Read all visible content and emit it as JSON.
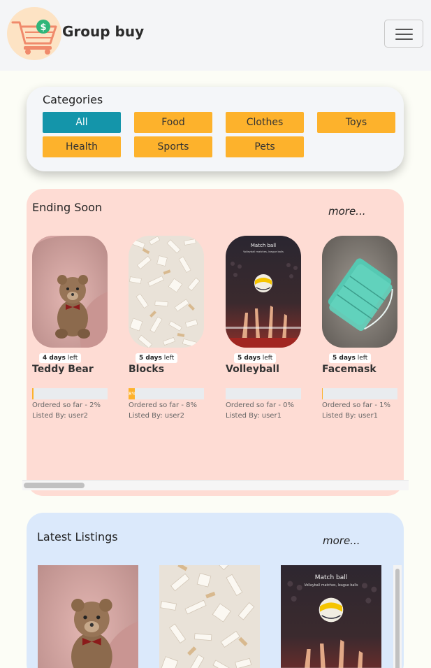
{
  "brand": {
    "title": "Group buy",
    "logo": "shopping-cart-dollar-logo"
  },
  "navbar": {
    "toggler_icon": "hamburger-menu-icon"
  },
  "categories": {
    "title": "Categories",
    "items": [
      {
        "label": "All",
        "active": true
      },
      {
        "label": "Food",
        "active": false
      },
      {
        "label": "Clothes",
        "active": false
      },
      {
        "label": "Toys",
        "active": false
      },
      {
        "label": "Health",
        "active": false
      },
      {
        "label": "Sports",
        "active": false
      },
      {
        "label": "Pets",
        "active": false
      }
    ]
  },
  "ending_soon": {
    "title": "Ending Soon",
    "more_label": "more...",
    "items": [
      {
        "name": "Teddy Bear",
        "days_num": "4 days",
        "days_suffix": "left",
        "progress": 2,
        "ordered_label": "Ordered so far - 2%",
        "listed_label": "Listed By: user2",
        "image": "teddy-bear"
      },
      {
        "name": "Blocks",
        "days_num": "5 days",
        "days_suffix": "left",
        "progress": 8,
        "progress_label": "8%",
        "ordered_label": "Ordered so far - 8%",
        "listed_label": "Listed By: user2",
        "image": "blocks"
      },
      {
        "name": "Volleyball",
        "days_num": "5 days",
        "days_suffix": "left",
        "progress": 0,
        "ordered_label": "Ordered so far - 0%",
        "listed_label": "Listed By: user1",
        "image": "volleyball",
        "image_text_title": "Match ball",
        "image_text_sub": "Volleyball matches, league balls"
      },
      {
        "name": "Facemask",
        "days_num": "5 days",
        "days_suffix": "left",
        "progress": 1,
        "ordered_label": "Ordered so far - 1%",
        "listed_label": "Listed By: user1",
        "image": "facemask"
      }
    ]
  },
  "latest_listings": {
    "title": "Latest Listings",
    "more_label": "more...",
    "items": [
      {
        "image": "teddy-bear"
      },
      {
        "image": "blocks"
      },
      {
        "image": "volleyball",
        "image_text_title": "Match ball",
        "image_text_sub": "Volleyball matches, league balls"
      }
    ]
  },
  "colors": {
    "accent_active": "#1495aa",
    "category_button": "#fdb22c",
    "ending_soon_bg": "#fedcd4",
    "latest_bg": "#dbe9fb",
    "progress_fill": "#fdb22c"
  }
}
